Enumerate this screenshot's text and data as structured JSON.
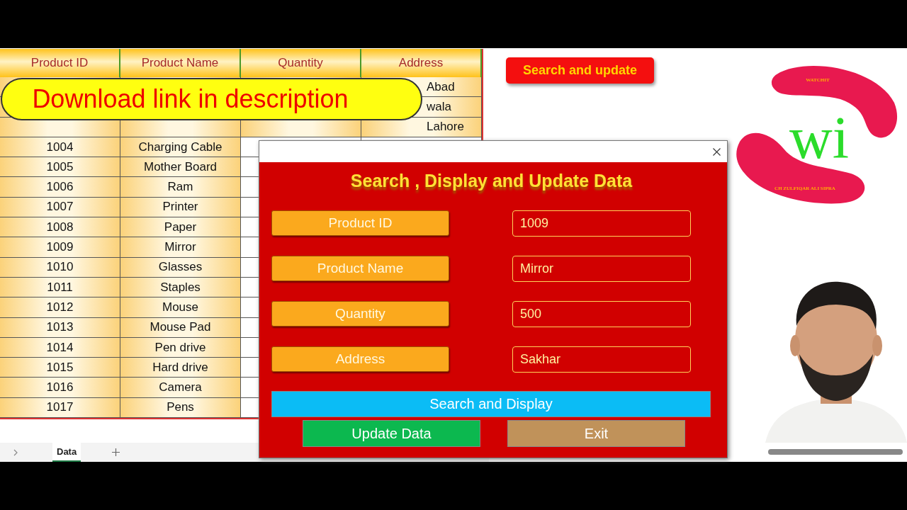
{
  "sheet": {
    "columns": [
      "Product ID",
      "Product Name",
      "Quantity",
      "Address"
    ],
    "rows": [
      {
        "id": "",
        "name": "",
        "quantity": "",
        "address": "Abad"
      },
      {
        "id": "",
        "address": "wala"
      },
      {
        "id": "",
        "name": "",
        "quantity": "",
        "address": "Lahore"
      },
      {
        "id": "1004",
        "name": "Charging Cable"
      },
      {
        "id": "1005",
        "name": "Mother Board"
      },
      {
        "id": "1006",
        "name": "Ram"
      },
      {
        "id": "1007",
        "name": "Printer"
      },
      {
        "id": "1008",
        "name": "Paper"
      },
      {
        "id": "1009",
        "name": "Mirror"
      },
      {
        "id": "1010",
        "name": "Glasses"
      },
      {
        "id": "1011",
        "name": "Staples"
      },
      {
        "id": "1012",
        "name": "Mouse"
      },
      {
        "id": "1013",
        "name": "Mouse Pad"
      },
      {
        "id": "1014",
        "name": "Pen drive"
      },
      {
        "id": "1015",
        "name": "Hard drive"
      },
      {
        "id": "1016",
        "name": "Camera"
      },
      {
        "id": "1017",
        "name": "Pens"
      }
    ],
    "tabs": [
      {
        "label": "Data",
        "selected": true
      }
    ]
  },
  "banner": "Download link in description",
  "sheet_button": "Search and update",
  "logo": {
    "top_text": "WATCHIT",
    "letters": "wi",
    "bottom_text": "CH ZULFIQAR ALI SIPRA"
  },
  "dialog": {
    "title": "Search , Display and Update Data",
    "fields": [
      {
        "label": "Product ID",
        "value": "1009"
      },
      {
        "label": "Product Name",
        "value": "Mirror"
      },
      {
        "label": "Quantity",
        "value": "500"
      },
      {
        "label": "Address",
        "value": "Sakhar"
      }
    ],
    "buttons": [
      {
        "label": "Search and Display",
        "kind": "wide"
      },
      {
        "label": "Update Data",
        "kind": "update"
      },
      {
        "label": "Exit",
        "kind": "exit"
      }
    ]
  }
}
